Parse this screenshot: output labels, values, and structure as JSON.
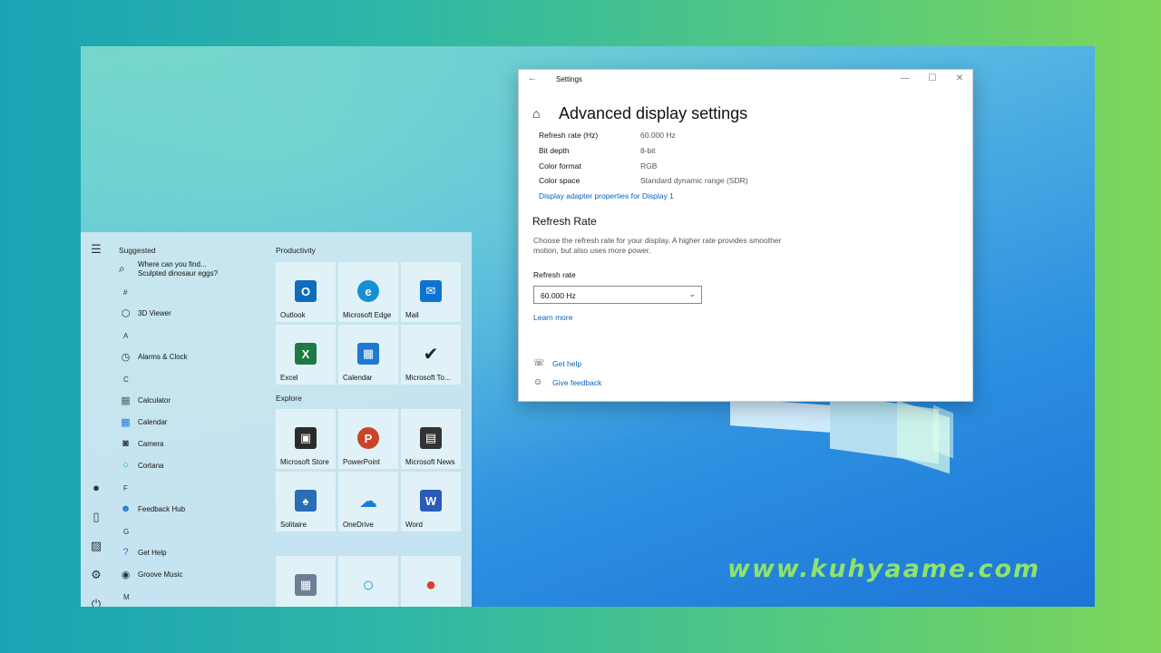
{
  "watermark": "www.kuhyaame.com",
  "settings": {
    "window_title": "Settings",
    "back_glyph": "←",
    "minimize_glyph": "—",
    "maximize_glyph": "☐",
    "close_glyph": "✕",
    "heading": "Advanced display settings",
    "properties": [
      {
        "label": "Refresh rate (Hz)",
        "value": "60.000 Hz"
      },
      {
        "label": "Bit depth",
        "value": "8-bit"
      },
      {
        "label": "Color format",
        "value": "RGB"
      },
      {
        "label": "Color space",
        "value": "Standard dynamic range (SDR)"
      }
    ],
    "adapter_link": "Display adapter properties for Display 1",
    "refresh_heading": "Refresh Rate",
    "refresh_description": "Choose the refresh rate for your display. A higher rate provides smoother motion, but also uses more power.",
    "dropdown_label": "Refresh rate",
    "dropdown_value": "60.000 Hz",
    "learn_more": "Learn more",
    "get_help": "Get help",
    "give_feedback": "Give feedback"
  },
  "start_menu": {
    "suggested_title": "Suggested",
    "suggestion_line1": "Where can you find...",
    "suggestion_line2": "Sculpted dinosaur eggs?",
    "productivity_title": "Productivity",
    "explore_title": "Explore",
    "letters": [
      "#",
      "A",
      "C",
      "F",
      "G",
      "M"
    ],
    "apps": [
      {
        "label": "3D Viewer",
        "icon": "cube-icon"
      },
      {
        "label": "Alarms & Clock",
        "icon": "clock-icon"
      },
      {
        "label": "Calculator",
        "icon": "calculator-icon"
      },
      {
        "label": "Calendar",
        "icon": "calendar-icon"
      },
      {
        "label": "Camera",
        "icon": "camera-icon"
      },
      {
        "label": "Cortana",
        "icon": "cortana-icon"
      },
      {
        "label": "Feedback Hub",
        "icon": "feedback-icon"
      },
      {
        "label": "Get Help",
        "icon": "help-icon"
      },
      {
        "label": "Groove Music",
        "icon": "music-icon"
      }
    ],
    "productivity_tiles": [
      {
        "label": "Outlook",
        "glyph": "O",
        "color": "#0f6cbd"
      },
      {
        "label": "Microsoft Edge",
        "glyph": "e",
        "color": "#1590d6"
      },
      {
        "label": "Mail",
        "glyph": "✉",
        "color": "#0e73d0"
      },
      {
        "label": "Excel",
        "glyph": "X",
        "color": "#1d7a45"
      },
      {
        "label": "Calendar",
        "glyph": "▦",
        "color": "#1f78d1"
      },
      {
        "label": "Microsoft To...",
        "glyph": "✔",
        "color": "#222222"
      }
    ],
    "explore_tiles": [
      {
        "label": "Microsoft Store",
        "glyph": "▣",
        "color": "#2b2b2b"
      },
      {
        "label": "PowerPoint",
        "glyph": "P",
        "color": "#c9442a"
      },
      {
        "label": "Microsoft News",
        "glyph": "▤",
        "color": "#333333"
      },
      {
        "label": "Solitaire",
        "glyph": "♠",
        "color": "#2a6db5"
      },
      {
        "label": "OneDrive",
        "glyph": "☁",
        "color": "#1a7fd4"
      },
      {
        "label": "Word",
        "glyph": "W",
        "color": "#2a5bb8"
      }
    ],
    "bottom_tiles": [
      {
        "glyph": "▦",
        "color": "#6b7f95"
      },
      {
        "glyph": "○",
        "color": "#1aa0e8"
      },
      {
        "glyph": "●",
        "color": "#d9442a"
      }
    ]
  }
}
